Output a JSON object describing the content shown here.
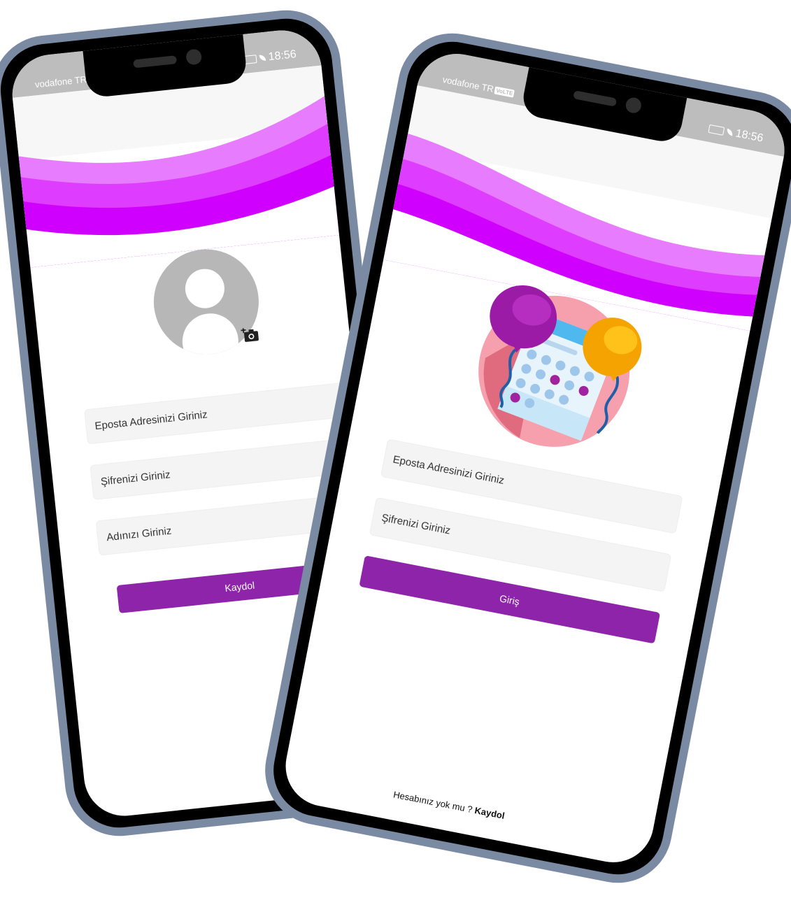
{
  "status_bar": {
    "carrier": "vodafone TR",
    "volte": "VoLTE",
    "time": "18:56"
  },
  "register_screen": {
    "email_placeholder": "Eposta Adresinizi Giriniz",
    "password_placeholder": "Şifrenizi Giriniz",
    "name_placeholder": "Adınızı Giriniz",
    "register_button": "Kaydol"
  },
  "login_screen": {
    "email_placeholder": "Eposta Adresinizi Giriniz",
    "password_placeholder": "Şifrenizi Giriniz",
    "login_button": "Giriş",
    "footer_prompt": "Hesabınız yok mu ?",
    "footer_link": "Kaydol"
  },
  "colors": {
    "wave_light": "#e87cff",
    "wave_mid": "#de3cff",
    "wave_dark": "#d000ff",
    "button": "#8e24aa",
    "frame": "#7b8aa3"
  },
  "icons": [
    "avatar-placeholder-icon",
    "add-photo-camera-icon",
    "calendar-balloons-illustration"
  ]
}
